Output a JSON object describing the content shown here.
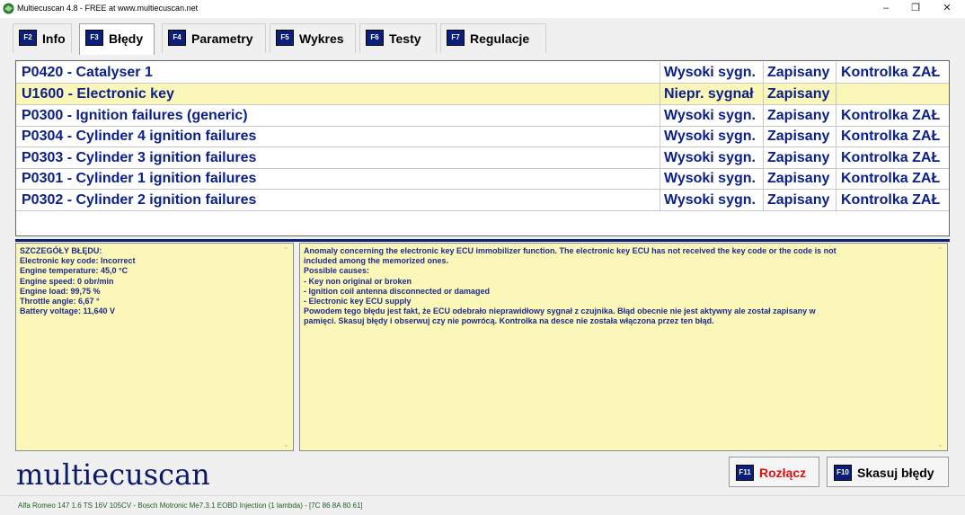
{
  "window": {
    "title": "Multiecuscan 4.8 - FREE at www.multiecuscan.net",
    "minimize": "–",
    "restore": "❐",
    "close": "✕"
  },
  "tabs": [
    {
      "key": "F2",
      "label": "Info",
      "active": false
    },
    {
      "key": "F3",
      "label": "Błędy",
      "active": true
    },
    {
      "key": "F4",
      "label": "Parametry",
      "active": false
    },
    {
      "key": "F5",
      "label": "Wykres",
      "active": false
    },
    {
      "key": "F6",
      "label": "Testy",
      "active": false
    },
    {
      "key": "F7",
      "label": "Regulacje",
      "active": false
    }
  ],
  "fault_codes": [
    {
      "code": "P0420 - Catalyser 1",
      "signal": "Wysoki sygn.",
      "status": "Zapisany",
      "lamp": "Kontrolka ZAŁ"
    },
    {
      "code": "U1600 - Electronic key",
      "signal": "Niepr. sygnał",
      "status": "Zapisany",
      "lamp": ""
    },
    {
      "code": "P0300 - Ignition failures (generic)",
      "signal": "Wysoki sygn.",
      "status": "Zapisany",
      "lamp": "Kontrolka ZAŁ"
    },
    {
      "code": "P0304 - Cylinder 4 ignition failures",
      "signal": "Wysoki sygn.",
      "status": "Zapisany",
      "lamp": "Kontrolka ZAŁ"
    },
    {
      "code": "P0303 - Cylinder 3 ignition failures",
      "signal": "Wysoki sygn.",
      "status": "Zapisany",
      "lamp": "Kontrolka ZAŁ"
    },
    {
      "code": "P0301 - Cylinder 1 ignition failures",
      "signal": "Wysoki sygn.",
      "status": "Zapisany",
      "lamp": "Kontrolka ZAŁ"
    },
    {
      "code": "P0302 - Cylinder 2 ignition failures",
      "signal": "Wysoki sygn.",
      "status": "Zapisany",
      "lamp": "Kontrolka ZAŁ"
    }
  ],
  "selected_row": 1,
  "details": {
    "text": "SZCZEGÓŁY BŁĘDU:\nElectronic key code: Incorrect\nEngine temperature: 45,0 °C\nEngine speed: 0 obr/min\nEngine load: 99,75 %\nThrottle angle: 6,67 °\nBattery voltage: 11,640 V"
  },
  "description": {
    "text": "Anomaly concerning the electronic key ECU immobilizer function. The electronic key ECU has not received the key code or the code is not\nincluded among the memorized ones.\nPossible causes:\n- Key non original or broken\n- Ignition coil antenna disconnected or damaged\n- Electronic key ECU supply\nPowodem tego błędu jest fakt, że ECU odebrało nieprawidłowy sygnał z czujnika. Błąd obecnie nie jest aktywny ale został zapisany w\npamięci. Skasuj błędy i obserwuj czy nie powrócą. Kontrolka na desce nie została włączona przez ten błąd."
  },
  "logo": "multiecuscan",
  "buttons": {
    "disconnect": {
      "key": "F11",
      "label": "Rozłącz",
      "color": "#e01010"
    },
    "clear": {
      "key": "F10",
      "label": "Skasuj błędy",
      "color": "#000000"
    }
  },
  "status_bar": "Alfa Romeo 147 1.6 TS 16V 105CV - Bosch Motronic Me7.3.1 EOBD Injection (1 lambda) - [7C 86 8A 80 61]",
  "colors": {
    "accent": "#0b1f78",
    "selected_row": "#fbf7b9",
    "code_text": "#0b1f8a"
  }
}
